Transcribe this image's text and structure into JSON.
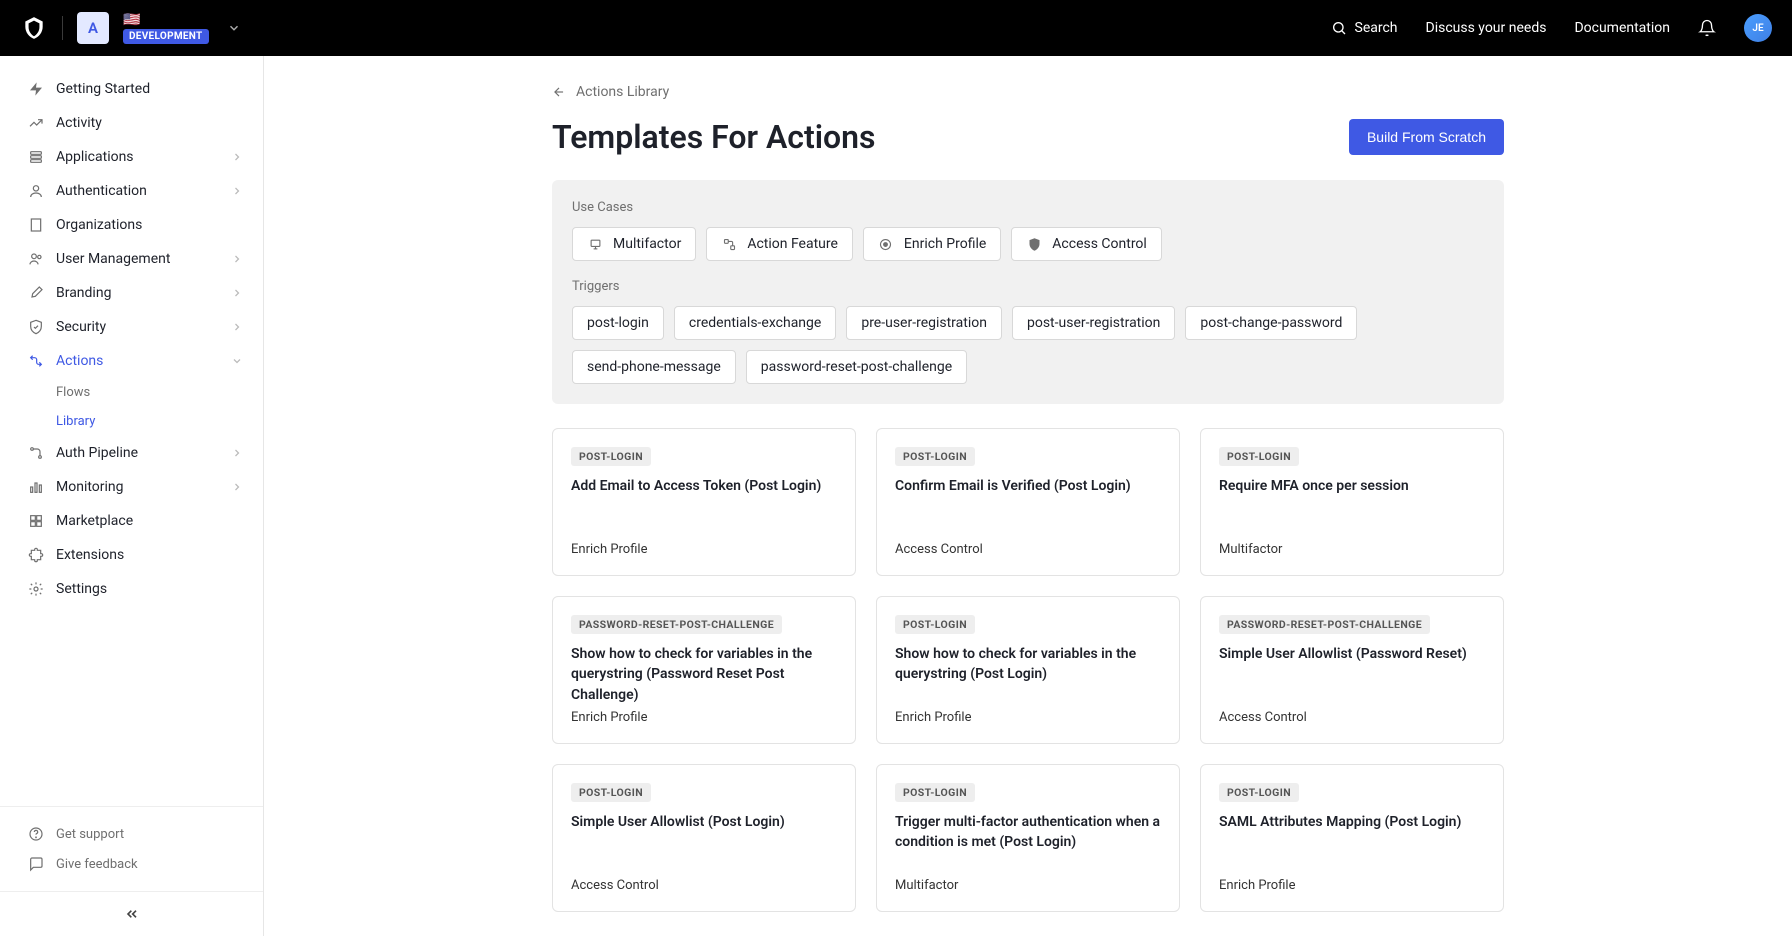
{
  "topnav": {
    "tenant_initial": "A",
    "env_badge": "DEVELOPMENT",
    "search": "Search",
    "discuss": "Discuss your needs",
    "docs": "Documentation",
    "avatar_initials": "JE"
  },
  "sidebar": {
    "items": [
      {
        "label": "Getting Started",
        "icon": "bolt"
      },
      {
        "label": "Activity",
        "icon": "chart"
      },
      {
        "label": "Applications",
        "icon": "stack",
        "expandable": true
      },
      {
        "label": "Authentication",
        "icon": "user-circle",
        "expandable": true
      },
      {
        "label": "Organizations",
        "icon": "building"
      },
      {
        "label": "User Management",
        "icon": "users",
        "expandable": true
      },
      {
        "label": "Branding",
        "icon": "brush",
        "expandable": true
      },
      {
        "label": "Security",
        "icon": "shield-check",
        "expandable": true
      },
      {
        "label": "Actions",
        "icon": "flow",
        "active": true,
        "expandable": true,
        "expanded": true,
        "children": [
          {
            "label": "Flows"
          },
          {
            "label": "Library",
            "active": true
          }
        ]
      },
      {
        "label": "Auth Pipeline",
        "icon": "pipeline",
        "expandable": true
      },
      {
        "label": "Monitoring",
        "icon": "bars",
        "expandable": true
      },
      {
        "label": "Marketplace",
        "icon": "grid"
      },
      {
        "label": "Extensions",
        "icon": "puzzle"
      },
      {
        "label": "Settings",
        "icon": "gear"
      }
    ],
    "bottom": [
      {
        "label": "Get support",
        "icon": "help"
      },
      {
        "label": "Give feedback",
        "icon": "feedback"
      }
    ]
  },
  "page": {
    "back_label": "Actions Library",
    "title": "Templates For Actions",
    "build_btn": "Build From Scratch"
  },
  "filters": {
    "usecases_label": "Use Cases",
    "usecases": [
      "Multifactor",
      "Action Feature",
      "Enrich Profile",
      "Access Control"
    ],
    "triggers_label": "Triggers",
    "triggers": [
      "post-login",
      "credentials-exchange",
      "pre-user-registration",
      "post-user-registration",
      "post-change-password",
      "send-phone-message",
      "password-reset-post-challenge"
    ]
  },
  "cards": [
    {
      "trigger": "POST-LOGIN",
      "title": "Add Email to Access Token (Post Login)",
      "use": "Enrich Profile"
    },
    {
      "trigger": "POST-LOGIN",
      "title": "Confirm Email is Verified (Post Login)",
      "use": "Access Control"
    },
    {
      "trigger": "POST-LOGIN",
      "title": "Require MFA once per session",
      "use": "Multifactor"
    },
    {
      "trigger": "PASSWORD-RESET-POST-CHALLENGE",
      "title": "Show how to check for variables in the querystring (Password Reset Post Challenge)",
      "use": "Enrich Profile"
    },
    {
      "trigger": "POST-LOGIN",
      "title": "Show how to check for variables in the querystring (Post Login)",
      "use": "Enrich Profile"
    },
    {
      "trigger": "PASSWORD-RESET-POST-CHALLENGE",
      "title": "Simple User Allowlist (Password Reset)",
      "use": "Access Control"
    },
    {
      "trigger": "POST-LOGIN",
      "title": "Simple User Allowlist (Post Login)",
      "use": "Access Control"
    },
    {
      "trigger": "POST-LOGIN",
      "title": "Trigger multi-factor authentication when a condition is met (Post Login)",
      "use": "Multifactor"
    },
    {
      "trigger": "POST-LOGIN",
      "title": "SAML Attributes Mapping (Post Login)",
      "use": "Enrich Profile"
    }
  ]
}
